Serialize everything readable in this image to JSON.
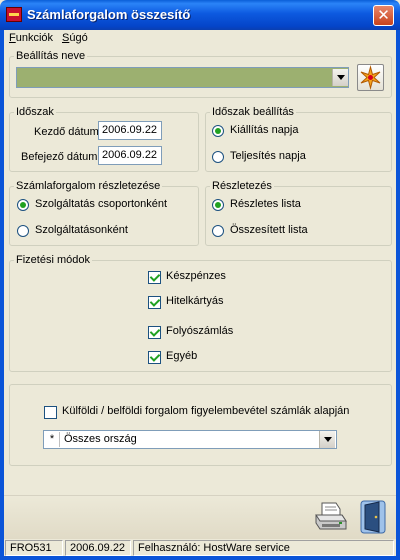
{
  "window": {
    "title": "Számlaforgalom összesítő"
  },
  "menu": {
    "items": [
      "Funkciók",
      "Súgó"
    ]
  },
  "settings": {
    "label": "Beállítás neve",
    "value": ""
  },
  "period": {
    "label": "Időszak",
    "start_label": "Kezdő dátum",
    "start_value": "2006.09.22",
    "end_label": "Befejező dátum",
    "end_value": "2006.09.22"
  },
  "period_setting": {
    "label": "Időszak beállítás",
    "options": [
      "Kiállítás napja",
      "Teljesítés napja"
    ],
    "selected": 0
  },
  "detail_level": {
    "label": "Számlaforgalom részletezése",
    "options": [
      "Szolgáltatás csoportonként",
      "Szolgáltatásonként"
    ],
    "selected": 0
  },
  "details": {
    "label": "Részletezés",
    "options": [
      "Részletes lista",
      "Összesített lista"
    ],
    "selected": 0
  },
  "payment": {
    "label": "Fizetési módok",
    "items": [
      {
        "label": "Készpénzes",
        "checked": true
      },
      {
        "label": "Hitelkártyás",
        "checked": true
      },
      {
        "label": "Folyószámlás",
        "checked": true
      },
      {
        "label": "Egyéb",
        "checked": true
      }
    ]
  },
  "foreign": {
    "checkbox_label": "Külföldi / belföldi forgalom figyelembevétel számlák alapján",
    "checked": false,
    "country_prefix": "*",
    "country_value": "Összes ország"
  },
  "status": {
    "code": "FRO531",
    "date": "2006.09.22",
    "user": "Felhasználó: HostWare service"
  },
  "icons": {
    "new_setting": "sparkle-icon",
    "print": "printer-icon",
    "exit": "door-exit-icon"
  }
}
